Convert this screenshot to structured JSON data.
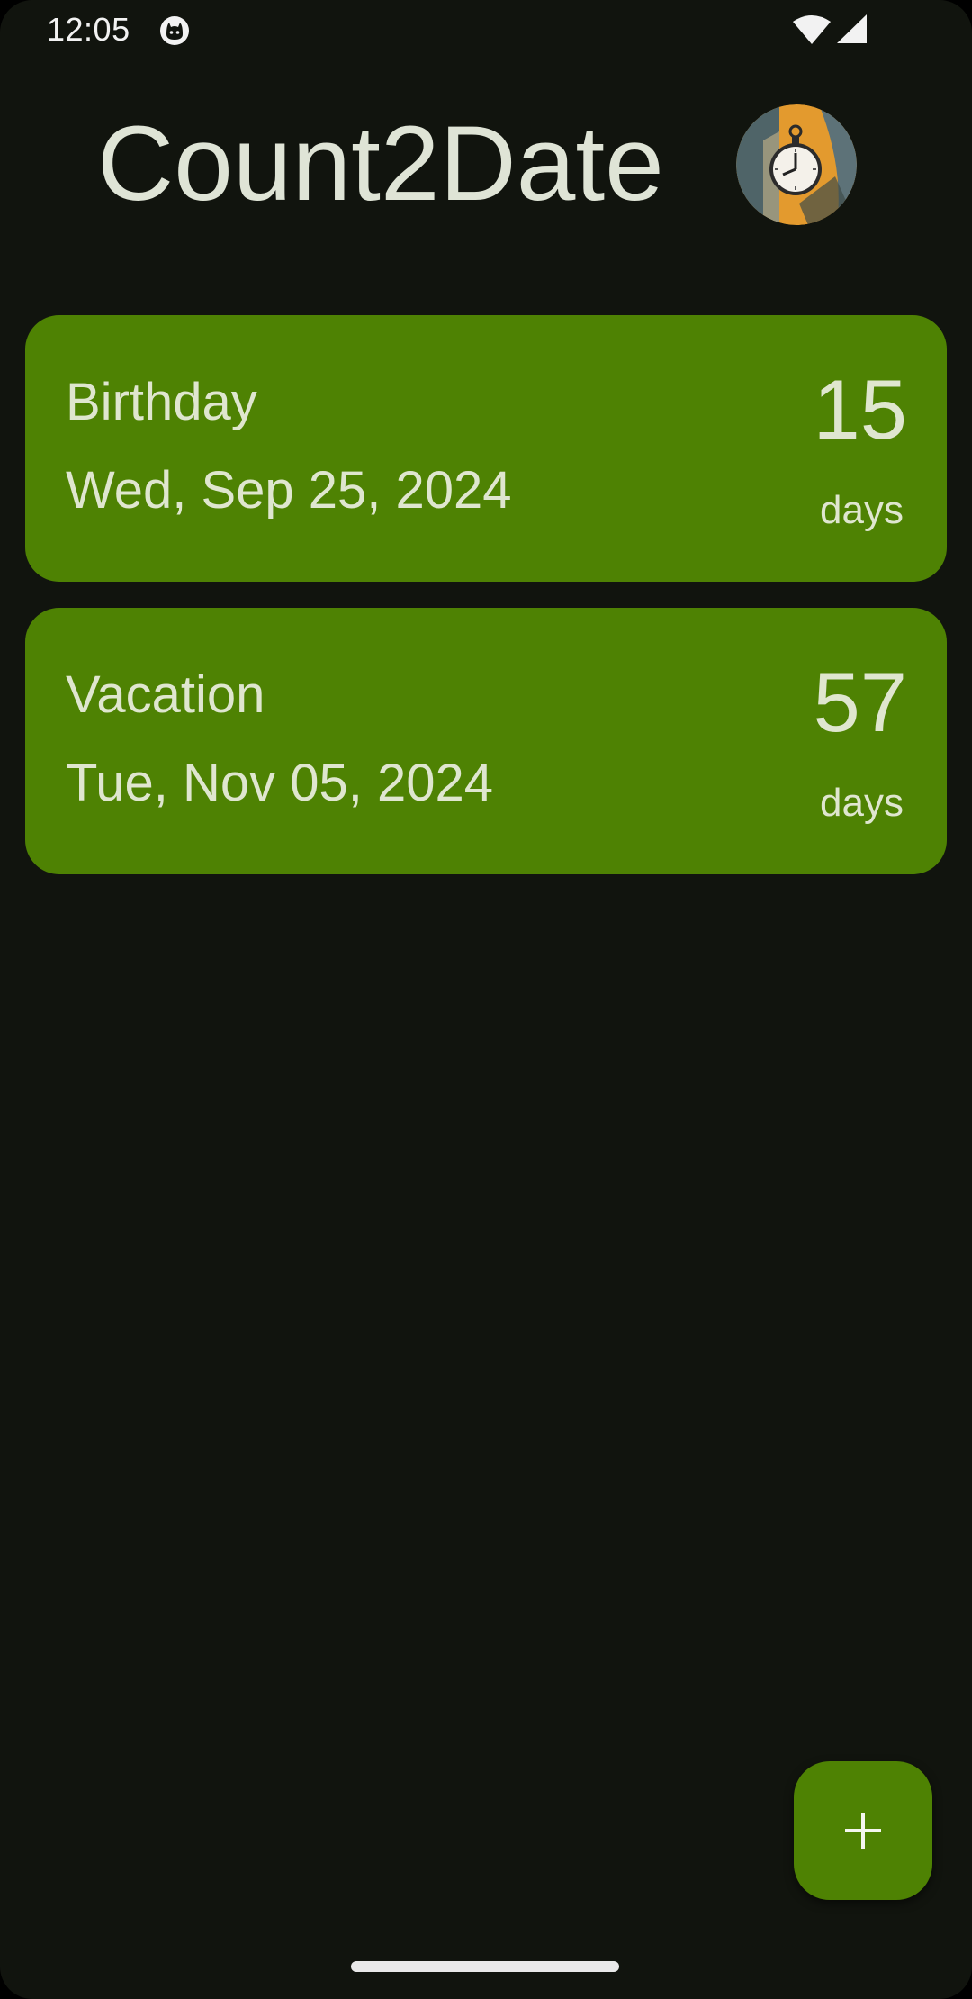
{
  "status_bar": {
    "time": "12:05",
    "icons": [
      "cat-notification-icon",
      "wifi-icon",
      "cellular-signal-icon"
    ]
  },
  "header": {
    "title": "Count2Date",
    "logo_icon": "stopwatch-logo-icon"
  },
  "events": [
    {
      "name": "Birthday",
      "date": "Wed, Sep 25, 2024",
      "count": "15",
      "unit": "days"
    },
    {
      "name": "Vacation",
      "date": "Tue, Nov 05, 2024",
      "count": "57",
      "unit": "days"
    }
  ],
  "fab": {
    "icon": "plus-icon"
  },
  "colors": {
    "background": "#11140e",
    "card": "#4e8203",
    "text": "#dfe6cf"
  }
}
